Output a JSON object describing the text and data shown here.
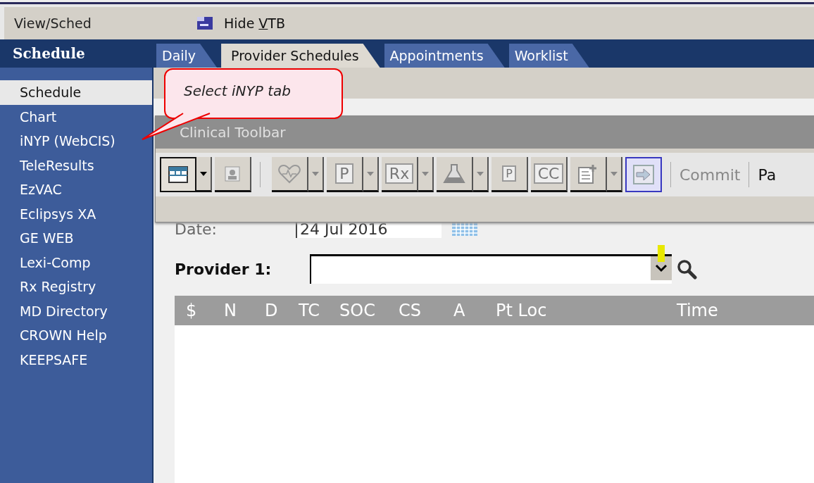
{
  "menu_bar": {
    "view_label": "View/Sched",
    "hide_button": {
      "before": "Hide ",
      "mnemonic": "V",
      "after": "TB"
    }
  },
  "header": {
    "title": "Schedule"
  },
  "tabs": [
    {
      "label": "Daily",
      "selected": false
    },
    {
      "label": "Provider Schedules",
      "selected": true
    },
    {
      "label": "Appointments",
      "selected": false
    },
    {
      "label": "Worklist",
      "selected": false
    }
  ],
  "sidebar": {
    "items": [
      {
        "label": "Schedule",
        "selected": true
      },
      {
        "label": "Chart",
        "selected": false
      },
      {
        "label": "iNYP (WebCIS)",
        "selected": false
      },
      {
        "label": "TeleResults",
        "selected": false
      },
      {
        "label": "EzVAC",
        "selected": false
      },
      {
        "label": "Eclipsys XA",
        "selected": false
      },
      {
        "label": "GE WEB",
        "selected": false
      },
      {
        "label": "Lexi-Comp",
        "selected": false
      },
      {
        "label": "Rx Registry",
        "selected": false
      },
      {
        "label": "MD Directory",
        "selected": false
      },
      {
        "label": "CROWN Help",
        "selected": false
      },
      {
        "label": "KEEPSAFE",
        "selected": false
      }
    ]
  },
  "callout": {
    "text": "Select iNYP tab"
  },
  "clinical_toolbar": {
    "title": "Clinical Toolbar",
    "items": [
      {
        "kind": "calendar",
        "dropdown": true,
        "highlighted": false
      },
      {
        "kind": "person",
        "dropdown": false,
        "highlighted": false
      },
      {
        "kind": "heart",
        "dropdown": true,
        "highlighted": false
      },
      {
        "kind": "letter",
        "label": "P",
        "dropdown": true,
        "highlighted": false
      },
      {
        "kind": "letter",
        "label": "Rx",
        "dropdown": true,
        "highlighted": false
      },
      {
        "kind": "flask",
        "dropdown": true,
        "highlighted": false
      },
      {
        "kind": "copy",
        "label": "P",
        "dropdown": false,
        "highlighted": false
      },
      {
        "kind": "letter",
        "label": "CC",
        "dropdown": false,
        "highlighted": false
      },
      {
        "kind": "note",
        "dropdown": true,
        "highlighted": false
      },
      {
        "kind": "arrow",
        "dropdown": false,
        "highlighted": true
      }
    ],
    "commit": "Commit",
    "cut_label": "Pa"
  },
  "form": {
    "date_label": "Date:",
    "date_value": "24 Jul 2016",
    "provider_label": "Provider 1:"
  },
  "table": {
    "columns": [
      "$",
      "N",
      "D",
      "TC",
      "SOC",
      "CS",
      "A",
      "Pt Loc",
      "Time"
    ]
  }
}
